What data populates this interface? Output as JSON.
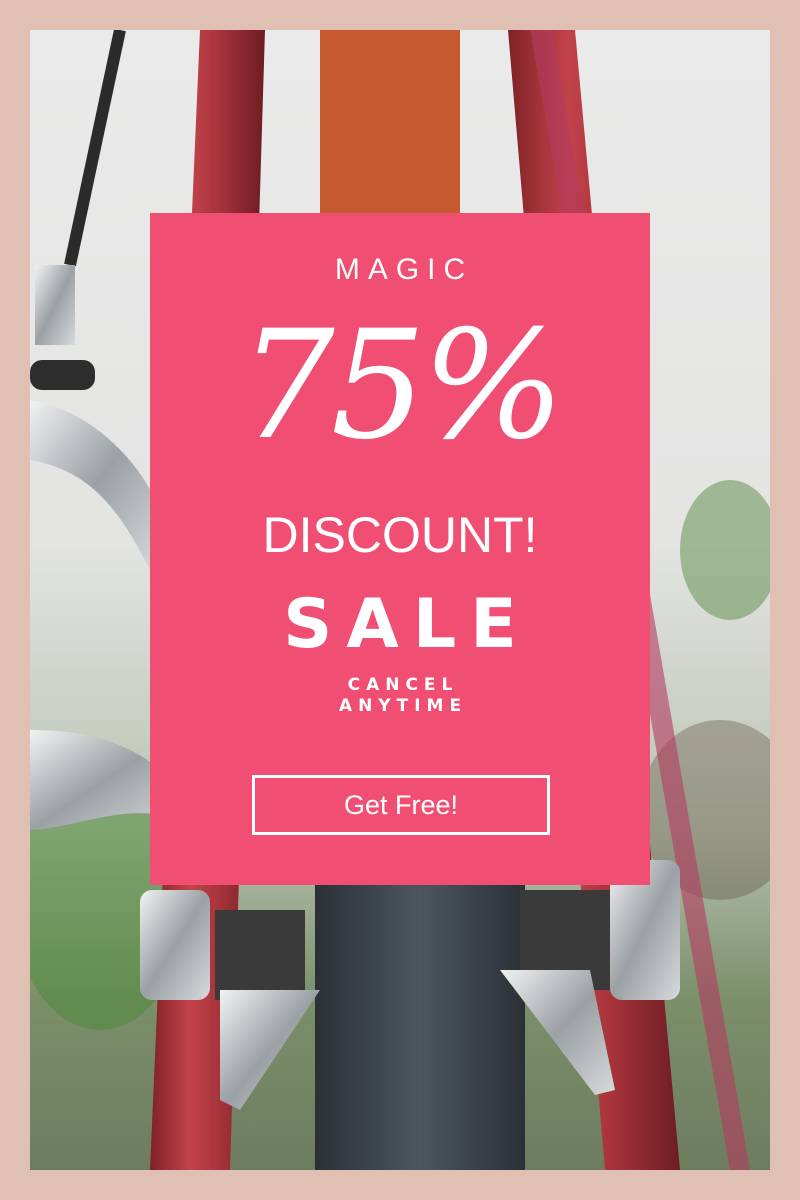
{
  "poster": {
    "eyebrow": "MAGIC",
    "headline": "75%",
    "subheadline": "DISCOUNT!",
    "sale": "SALE",
    "tagline_line1": "CANCEL",
    "tagline_line2": "ANYTIME",
    "cta_label": "Get Free!"
  },
  "background": {
    "subject": "bicycle-brake-photo"
  },
  "colors": {
    "border": "#e1c0b4",
    "card": "#f04f73",
    "text": "#ffffff",
    "frame_tube": "#a8333a"
  }
}
